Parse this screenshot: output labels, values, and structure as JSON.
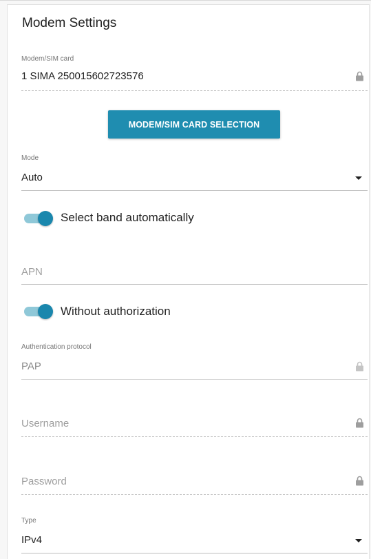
{
  "section": {
    "title": "Modem Settings"
  },
  "modem_sim": {
    "label": "Modem/SIM card",
    "value": "1 SIMA 250015602723576",
    "locked": true
  },
  "selection_button": {
    "label": "MODEM/SIM CARD SELECTION"
  },
  "mode": {
    "label": "Mode",
    "value": "Auto"
  },
  "band_toggle": {
    "label": "Select band automatically",
    "checked": true
  },
  "apn": {
    "placeholder": "APN"
  },
  "auth_toggle": {
    "label": "Without authorization",
    "checked": true
  },
  "auth_protocol": {
    "label": "Authentication protocol",
    "value": "PAP",
    "locked": true
  },
  "username": {
    "placeholder": "Username",
    "locked": true
  },
  "password": {
    "placeholder": "Password",
    "locked": true
  },
  "type": {
    "label": "Type",
    "value": "IPv4"
  },
  "colors": {
    "accent": "#1f8db0",
    "toggle_track": "#8fc8d8",
    "toggle_thumb": "#1a87ad"
  },
  "icons": {
    "lock": "lock-icon",
    "dropdown": "chevron-down-icon"
  }
}
